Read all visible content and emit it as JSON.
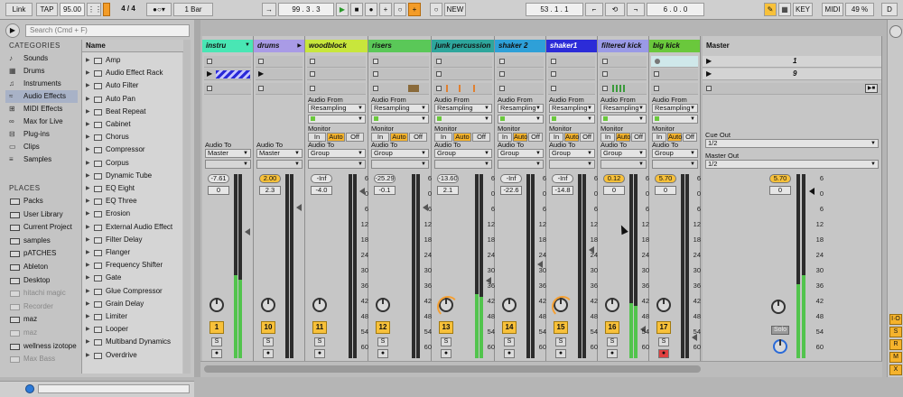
{
  "toolbar": {
    "link": "Link",
    "tap": "TAP",
    "tempo": "95.00",
    "sig_num": "4",
    "sig_slash": "/",
    "sig_den": "4",
    "quant": "1 Bar",
    "position": "99 .   3 .   3",
    "new_btn": "NEW",
    "loop_start": "53 .   1 .   1",
    "loop_len": "6 .   0 .   0",
    "key": "KEY",
    "midi": "MIDI",
    "cpu": "49 %",
    "d": "D"
  },
  "browser": {
    "search_placeholder": "Search (Cmd + F)",
    "categories_header": "CATEGORIES",
    "categories": [
      "Sounds",
      "Drums",
      "Instruments",
      "Audio Effects",
      "MIDI Effects",
      "Max for Live",
      "Plug-ins",
      "Clips",
      "Samples"
    ],
    "categories_icons": [
      "♪",
      "▦",
      "♫",
      "≈",
      "⊞",
      "∞",
      "⊟",
      "▭",
      "≡"
    ],
    "places_header": "PLACES",
    "places": [
      "Packs",
      "User Library",
      "Current Project",
      "samples",
      "pATCHES",
      "Ableton",
      "Desktop",
      "hitachi magic",
      "Recorder",
      "maz",
      "maz",
      "wellness izotope",
      "Max Bass"
    ],
    "places_dim": [
      false,
      false,
      false,
      false,
      false,
      false,
      false,
      true,
      true,
      false,
      true,
      false,
      true
    ],
    "name_header": "Name",
    "items": [
      "Amp",
      "Audio Effect Rack",
      "Auto Filter",
      "Auto Pan",
      "Beat Repeat",
      "Cabinet",
      "Chorus",
      "Compressor",
      "Corpus",
      "Dynamic Tube",
      "EQ Eight",
      "EQ Three",
      "Erosion",
      "External Audio Effect",
      "Filter Delay",
      "Flanger",
      "Frequency Shifter",
      "Gate",
      "Glue Compressor",
      "Grain Delay",
      "Limiter",
      "Looper",
      "Multiband Dynamics",
      "Overdrive"
    ]
  },
  "tracks": [
    {
      "name": "instru",
      "color": "#49e6b4",
      "vol": "-7.61",
      "vol_hl": false,
      "pan": "0",
      "num": "1",
      "audio_to": "Master",
      "audio_from": "",
      "meter": 0.45,
      "fader": 0.25
    },
    {
      "name": "drums",
      "color": "#a99be6",
      "vol": "2.00",
      "vol_hl": true,
      "pan": "2.3",
      "num": "10",
      "audio_to": "Master",
      "audio_from": "",
      "meter": 0.0,
      "fader": 0.1
    },
    {
      "name": "woodblock",
      "color": "#c8e63c",
      "vol": "-Inf",
      "vol_hl": false,
      "pan": "-4.0",
      "num": "11",
      "audio_to": "Group",
      "audio_from": "Resampling",
      "meter": 0.0,
      "fader": 0.0
    },
    {
      "name": "risers",
      "color": "#5ac858",
      "vol": "-25.29",
      "vol_hl": false,
      "pan": "-0.1",
      "num": "12",
      "audio_to": "Group",
      "audio_from": "Resampling",
      "meter": 0.0,
      "fader": 0.1
    },
    {
      "name": "junk percussion",
      "color": "#2ea69c",
      "vol": "-13.60",
      "vol_hl": false,
      "pan": "2.1",
      "num": "13",
      "audio_to": "Group",
      "audio_from": "Resampling",
      "meter": 0.35,
      "fader": 0.55
    },
    {
      "name": "shaker 2",
      "color": "#2ea0d8",
      "vol": "-Inf",
      "vol_hl": false,
      "pan": "-22.6",
      "num": "14",
      "audio_to": "Group",
      "audio_from": "Resampling",
      "meter": 0.0,
      "fader": 0.45
    },
    {
      "name": "shaker1",
      "color": "#2c2cd8",
      "vol": "-Inf",
      "vol_hl": false,
      "pan": "-14.8",
      "num": "15",
      "audio_to": "Group",
      "audio_from": "Resampling",
      "meter": 0.0,
      "fader": 0.36
    },
    {
      "name": "filtered kick",
      "color": "#9a9ae6",
      "vol": "0.12",
      "vol_hl": true,
      "pan": "0",
      "num": "16",
      "audio_to": "Group",
      "audio_from": "Resampling",
      "meter": 0.3,
      "fader": 0.85
    },
    {
      "name": "big kick",
      "color": "#6ac83c",
      "vol": "5.70",
      "vol_hl": true,
      "pan": "0",
      "num": "17",
      "audio_to": "Group",
      "audio_from": "Resampling",
      "meter": 0.0,
      "fader": 0.9
    }
  ],
  "labels": {
    "audio_from": "Audio From",
    "monitor": "Monitor",
    "in": "In",
    "auto": "Auto",
    "off": "Off",
    "audio_to": "Audio To",
    "solo_letter": "S"
  },
  "master": {
    "name": "Master",
    "scene1": "1",
    "scene2": "9",
    "cue_out": "Cue Out",
    "cue_val": "1/2",
    "master_out": "Master Out",
    "master_val": "1/2",
    "vol": "5.70",
    "pan": "0",
    "solo": "Solo"
  },
  "scale": [
    "6",
    "0",
    "6",
    "12",
    "18",
    "24",
    "30",
    "36",
    "42",
    "48",
    "54",
    "60"
  ]
}
